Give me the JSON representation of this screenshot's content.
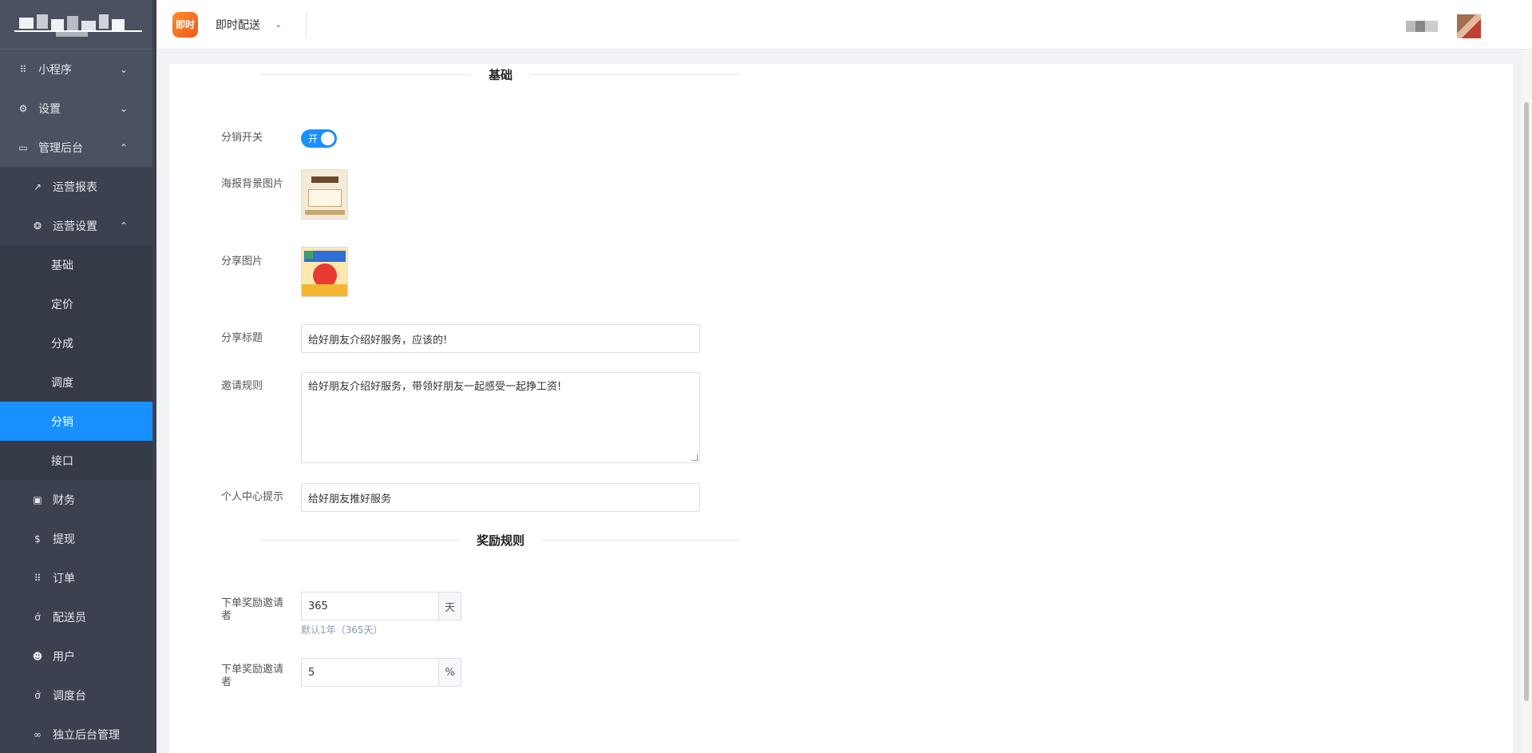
{
  "sidebar": {
    "items": [
      {
        "icon": "grid-icon",
        "glyph": "⠿",
        "label": "小程序",
        "chevron": "⌄"
      },
      {
        "icon": "gear-icon",
        "glyph": "⚙",
        "label": "设置",
        "chevron": "⌄"
      },
      {
        "icon": "monitor-icon",
        "glyph": "▭",
        "label": "管理后台",
        "chevron": "⌃"
      }
    ],
    "sub_items": [
      {
        "icon": "trend-icon",
        "glyph": "↗",
        "label": "运营报表"
      },
      {
        "icon": "settings-icon",
        "glyph": "❂",
        "label": "运营设置",
        "chevron": "⌃"
      }
    ],
    "ops_items": [
      "基础",
      "定价",
      "分成",
      "调度",
      "分销",
      "接口"
    ],
    "bottom_items": [
      {
        "icon": "money-icon",
        "glyph": "▣",
        "label": "财务"
      },
      {
        "icon": "dollar-icon",
        "glyph": "$",
        "label": "提现"
      },
      {
        "icon": "list-icon",
        "glyph": "⠿",
        "label": "订单"
      },
      {
        "icon": "bike-icon",
        "glyph": "ớ",
        "label": "配送员"
      },
      {
        "icon": "users-icon",
        "glyph": "☻",
        "label": "用户"
      },
      {
        "icon": "bike-icon",
        "glyph": "ớ",
        "label": "调度台"
      },
      {
        "icon": "link-icon",
        "glyph": "∞",
        "label": "独立后台管理"
      }
    ],
    "active": "分销"
  },
  "header": {
    "app_icon_text": "即时",
    "app_name": "即时配送",
    "chevron": "⌄"
  },
  "form": {
    "section_basic": "基础",
    "switch_label": "分销开关",
    "switch_text": "开",
    "switch_on": true,
    "poster_label": "海报背景图片",
    "share_image_label": "分享图片",
    "share_title_label": "分享标题",
    "share_title_value": "给好朋友介绍好服务，应该的!",
    "invite_rule_label": "邀请规则",
    "invite_rule_value": "给好朋友介绍好服务，带领好朋友一起感受一起挣工资!",
    "center_tip_label": "个人中心提示",
    "center_tip_value": "给好朋友推好服务",
    "section_reward": "奖励规则",
    "reward_days_label": "下单奖励邀请者",
    "reward_days_value": "365",
    "reward_days_unit": "天",
    "reward_days_hint": "默认1年（365天）",
    "reward_pct_label": "下单奖励邀请者",
    "reward_pct_value": "5",
    "reward_pct_unit": "%"
  },
  "colors": {
    "sidebar_bg": "#4a5160",
    "active_bg": "#1890ff",
    "accent": "#1890ff"
  }
}
